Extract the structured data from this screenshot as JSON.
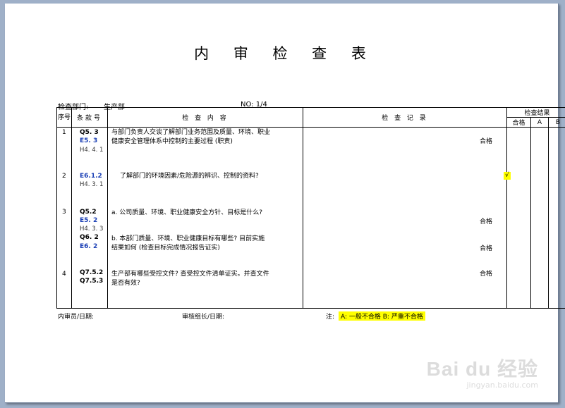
{
  "document": {
    "title": "内 审 检 查 表",
    "dept_label": "检查部门:",
    "dept_value": "生产部",
    "no_label": "NO: 1/4"
  },
  "table": {
    "headers": {
      "seq": "序号",
      "clause": "条款号",
      "content": "检 查 内 容",
      "record": "检 查 记 录",
      "result": "检查结果",
      "pass": "合格",
      "a": "A",
      "b": "B"
    },
    "rows": [
      {
        "seq": "1",
        "clauses": [
          "Q5. 3",
          "E5. 3",
          "H4. 4. 1"
        ],
        "content": "与部门负责人交谈了解部门业务范围及质量、环境、职业健康安全管理体系中控制的主要过程 (职责)",
        "pass": "合格"
      },
      {
        "seq": "2",
        "clauses": [
          "E6.1.2",
          "H4. 3. 1"
        ],
        "content": "了解部门的环境因素/危险源的辨识、控制的资料?",
        "a_mark": "√"
      },
      {
        "seq": "3",
        "clauses": [
          "Q5.2",
          "E5. 2",
          "H4. 3. 3",
          "Q6. 2",
          "E6. 2"
        ],
        "content_a": "a.   公司质量、环境、职业健康安全方针、目标是什么?",
        "content_b": "b.   本部门质量、环境、职业健康目标有哪些? 目前实施结果如何 (检查目标完成情况报告证实)",
        "pass_a": "合格",
        "pass_b": "合格"
      },
      {
        "seq": "4",
        "clauses": [
          "Q7.5.2",
          "Q7.5.3"
        ],
        "content": "生产部有哪些受控文件? 查受控文件清单证实。并查文件是否有效?",
        "pass": "合格"
      }
    ]
  },
  "footer": {
    "auditor": "内审员/日期:",
    "leader": "审核组长/日期:",
    "note_label": "注:",
    "note_text": "A: 一般不合格  B: 严重不合格"
  },
  "watermark": {
    "brand": "Bai du 经验",
    "url": "jingyan.baidu.com"
  }
}
